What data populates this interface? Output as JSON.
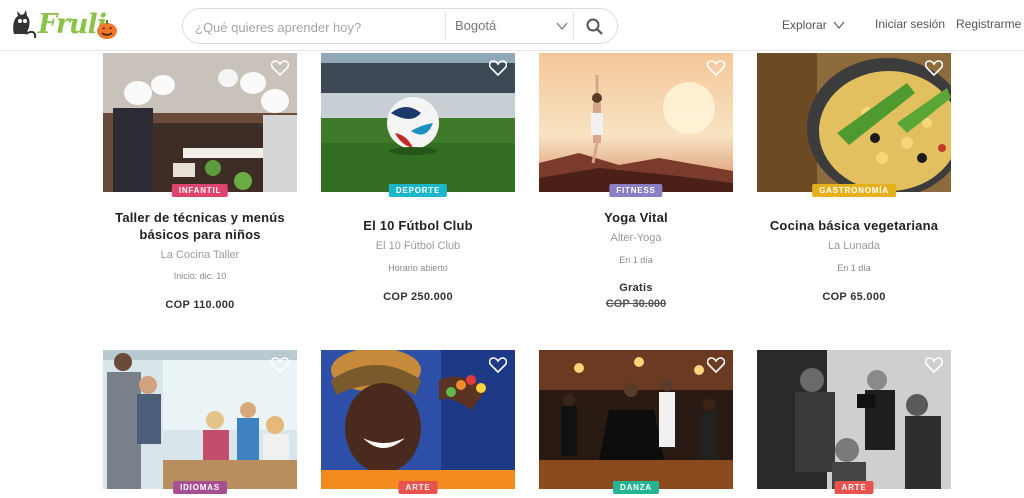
{
  "header": {
    "logo_text": "Fruli",
    "search_placeholder": "¿Qué quieres aprender hoy?",
    "city": "Bogotá",
    "explore_label": "Explorar",
    "login_label": "Iniciar sesión",
    "register_label": "Registrarme"
  },
  "colors": {
    "brand_green": "#8bc34a",
    "infantil": "#e0436b",
    "deporte": "#1ab6c9",
    "fitness": "#8a7fc2",
    "gastronomia": "#e5b019",
    "idiomas": "#a64f93",
    "arte": "#e8534e",
    "danza": "#25b594"
  },
  "cards": [
    {
      "category": "INFANTIL",
      "title_line1": "Taller de técnicas y menús",
      "title_line2": "básicos para niños",
      "org": "La Cocina Taller",
      "date": "Inicio: dic. 10",
      "price": "COP 110.000"
    },
    {
      "category": "DEPORTE",
      "title_line1": "El 10 Fútbol Club",
      "org": "El 10 Fútbol Club",
      "date": "Horario abierto",
      "price": "COP 250.000"
    },
    {
      "category": "FITNESS",
      "title_line1": "Yoga Vital",
      "org": "Alter-Yoga",
      "date": "En 1 día",
      "price": "Gratis",
      "old_price": "COP 30.000"
    },
    {
      "category": "GASTRONOMÍA",
      "title_line1": "Cocina básica vegetariana",
      "org": "La Lunada",
      "date": "En 1 día",
      "price": "COP 65.000"
    },
    {
      "category": "IDIOMAS"
    },
    {
      "category": "ARTE"
    },
    {
      "category": "DANZA"
    },
    {
      "category": "ARTE"
    }
  ]
}
